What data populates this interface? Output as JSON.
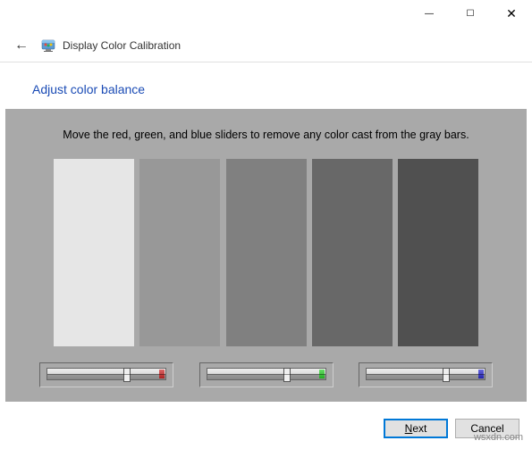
{
  "window": {
    "minimize_glyph": "—",
    "maximize_glyph": "☐",
    "close_glyph": "✕"
  },
  "header": {
    "title": "Display Color Calibration",
    "back_glyph": "←"
  },
  "page": {
    "heading": "Adjust color balance",
    "instruction": "Move the red, green, and blue sliders to remove any color cast from the gray bars."
  },
  "bars": {
    "colors": [
      "#e6e6e6",
      "#989898",
      "#808080",
      "#686868",
      "#505050"
    ]
  },
  "sliders": {
    "channels": [
      "red",
      "green",
      "blue"
    ]
  },
  "buttons": {
    "next_prefix": "N",
    "next_rest": "ext",
    "cancel": "Cancel"
  },
  "watermark": "wsxdn.com"
}
